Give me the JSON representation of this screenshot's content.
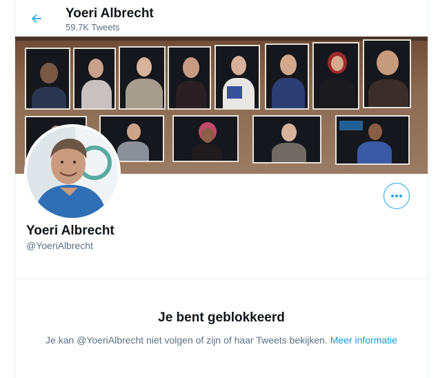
{
  "header": {
    "back_icon": "arrow-left-icon",
    "title": "Yoeri Albrecht",
    "tweet_count": "59,7K Tweets"
  },
  "banner": {
    "description_icon": "banner-photo-wall"
  },
  "profile": {
    "avatar_icon": "avatar-photo",
    "more_icon": "more-dots-icon",
    "name": "Yoeri Albrecht",
    "handle": "@YoeriAlbrecht"
  },
  "blocked": {
    "title": "Je bent geblokkeerd",
    "message": "Je kan @YoeriAlbrecht niet volgen of zijn of haar Tweets bekijken.",
    "link": "Meer informatie"
  },
  "colors": {
    "accent": "#1da1f2",
    "link": "#1b95e0",
    "muted": "#5b7083",
    "text": "#0f1419"
  }
}
